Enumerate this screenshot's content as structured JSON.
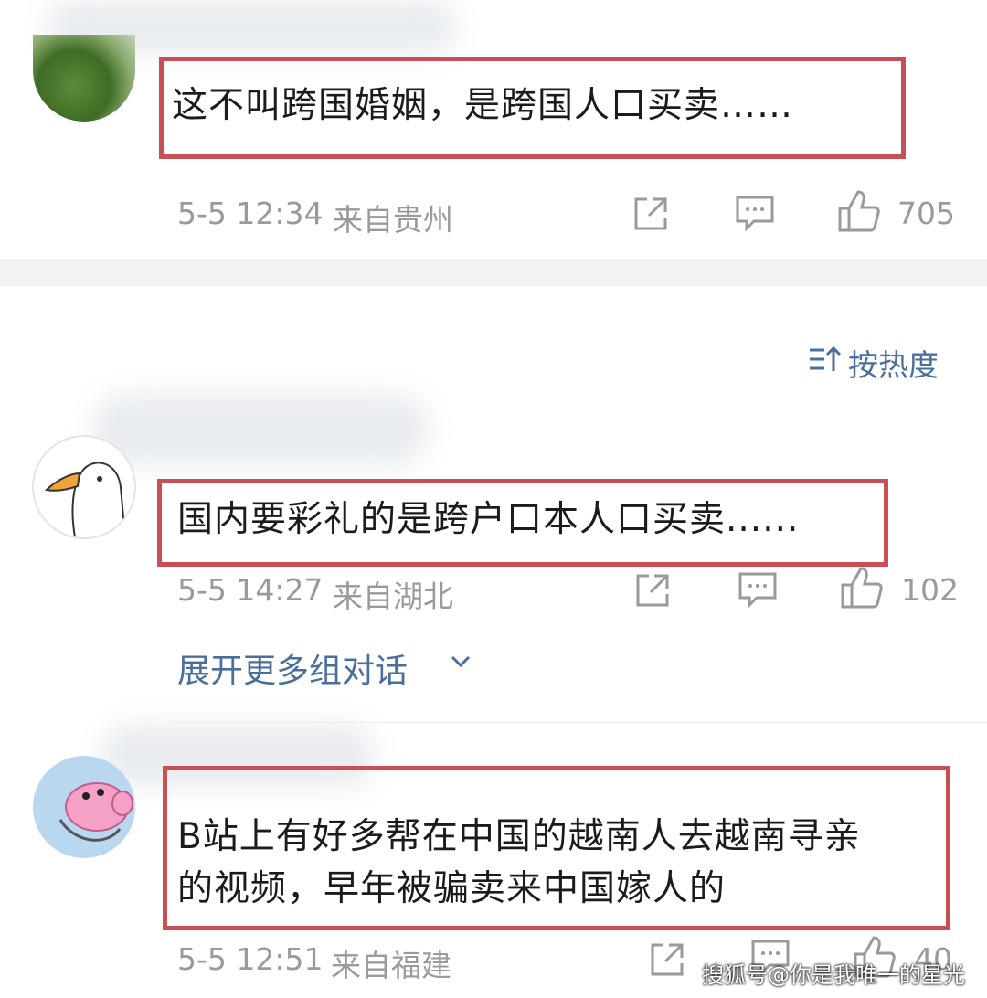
{
  "comments": [
    {
      "text": "这不叫跨国婚姻，是跨国人口买卖……",
      "date": "5-5 12:34",
      "location": "来自贵州",
      "likes": "705"
    },
    {
      "text": "国内要彩礼的是跨户口本人口买卖......",
      "date": "5-5 14:27",
      "location": "来自湖北",
      "likes": "102"
    },
    {
      "text_line1": "B站上有好多帮在中国的越南人去越南寻亲",
      "text_line2": "的视频，早年被骗卖来中国嫁人的",
      "date": "5-5 12:51",
      "location": "来自福建",
      "likes": "40"
    }
  ],
  "sort_label": "按热度",
  "expand_label": "展开更多组对话",
  "watermark": "搜狐号@你是我唯一的星光",
  "icons": [
    "share-icon",
    "comment-icon",
    "like-icon",
    "sort-icon",
    "chevron-down-icon"
  ],
  "colors": {
    "highlight": "#c94f57",
    "link": "#4a6f9a",
    "meta": "#9a9a9a"
  }
}
